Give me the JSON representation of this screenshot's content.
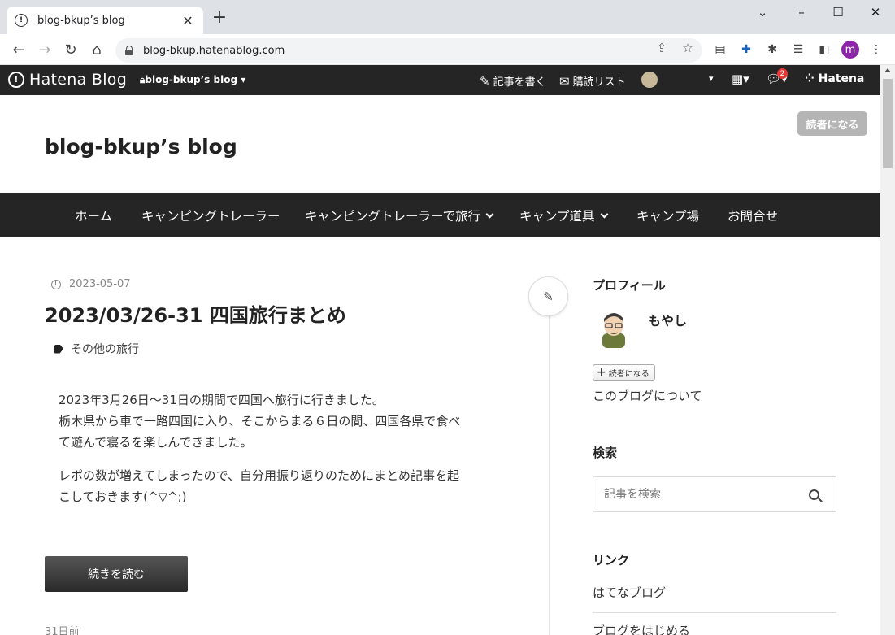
{
  "browser": {
    "tab_title": "blog-bkup’s blog",
    "url": "blog-bkup.hatenablog.com",
    "profile_initial": "m"
  },
  "hatena_bar": {
    "logo": "Hatena Blog",
    "blog_selector": "blog-bkup’s blog",
    "write": "記事を書く",
    "reading_list": "購読リスト",
    "notification_count": "2",
    "hatena": "Hatena"
  },
  "blog": {
    "title": "blog-bkup’s blog",
    "subscribe": "読者になる"
  },
  "nav": {
    "items": [
      {
        "label": "ホーム"
      },
      {
        "label": "キャンピングトレーラー"
      },
      {
        "label": "キャンピングトレーラーで旅行"
      },
      {
        "label": "キャンプ道具"
      },
      {
        "label": "キャンプ場"
      },
      {
        "label": "お問合せ"
      }
    ]
  },
  "article": {
    "date": "2023-05-07",
    "title": "2023/03/26-31 四国旅行まとめ",
    "category": "その他の旅行",
    "p1_l1": "2023年3月26日～31日の期間で四国へ旅行に行きました。",
    "p1_l2": "栃木県から車で一路四国に入り、そこからまる６日の間、四国各県で食べ",
    "p1_l3": "て遊んで寝るを楽しんできました。",
    "p2_l1": "レポの数が増えてしまったので、自分用振り返りのためにまとめ記事を起",
    "p2_l2": "こしておきます(^▽^;)",
    "read_more": "続きを読む",
    "ago": "31日前"
  },
  "sidebar": {
    "profile_heading": "プロフィール",
    "profile_name": "もやし",
    "subscribe": "読者になる",
    "about": "このブログについて",
    "search_heading": "検索",
    "search_placeholder": "記事を検索",
    "links_heading": "リンク",
    "link1": "はてなブログ",
    "link2": "ブログをはじめる"
  }
}
